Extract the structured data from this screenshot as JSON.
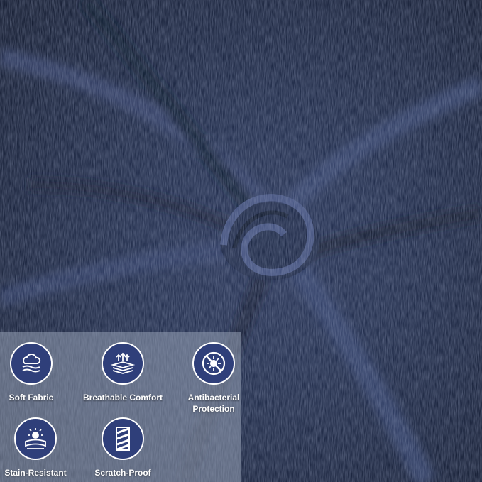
{
  "image": {
    "subject": "swirled-navy-chenille-fabric",
    "colors": {
      "fabric_base": "#1f2a44",
      "fabric_highlight": "#55628a",
      "badge_fill": "#2f3f7a",
      "panel_overlay": "#969fb4"
    }
  },
  "features": [
    {
      "label": "Soft Fabric",
      "icon": "cloud-fabric-icon"
    },
    {
      "label": "Breathable Comfort",
      "icon": "breathable-layers-icon"
    },
    {
      "label": "Antibacterial\nProtection",
      "icon": "antibacterial-icon"
    },
    {
      "label": "Stain-Resistant",
      "icon": "stain-resistant-icon"
    },
    {
      "label": "Scratch-Proof",
      "icon": "scratch-proof-icon"
    }
  ]
}
